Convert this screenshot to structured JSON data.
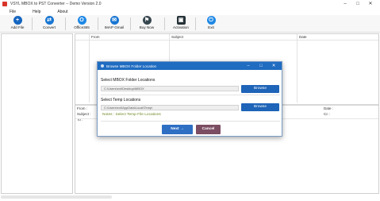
{
  "window": {
    "title": "VSYL MBOX to PST Converter -- Demo Version 2.0",
    "minimize": "–",
    "maximize": "□",
    "close": "✕"
  },
  "menu": {
    "file": "File",
    "help": "Help",
    "about": "About"
  },
  "toolbar": {
    "items": [
      {
        "label": "Add File",
        "glyph": "+",
        "color": "#1565c0"
      },
      {
        "label": "Convert",
        "glyph": "⇄",
        "color": "#1976d2"
      },
      {
        "label": "Office365",
        "glyph": "O",
        "color": "#1e88e5"
      },
      {
        "label": "IMAP Gmail",
        "glyph": "✉",
        "color": "#1976d2"
      },
      {
        "label": "Buy Now",
        "glyph": "⚑",
        "color": "#37474f"
      },
      {
        "label": "Activation",
        "glyph": "▣",
        "color": "#263238"
      },
      {
        "label": "Exit",
        "glyph": "⏻",
        "color": "#1e88e5"
      }
    ]
  },
  "list": {
    "columns": {
      "from": "From",
      "subject": "Subject",
      "date": "Date"
    }
  },
  "preview": {
    "from": "From :",
    "subject": "Subject :",
    "to": "To :",
    "date": "Date :",
    "cc": "Cc :"
  },
  "dialog": {
    "title": "Browse MBOX Folder Location",
    "mbox_label": "Select MBOX Folder Locations",
    "mbox_path": "C:\\Users\\ext\\Desktop\\MBOX",
    "temp_label": "Select Temp Locations",
    "temp_path": "C:\\Users\\ext\\AppData\\Local\\Temp\\",
    "browse_label": "Browse",
    "notes": "Notes : Select Temp File Locations",
    "next_label": "Next  →",
    "cancel_label": "Cancel"
  }
}
